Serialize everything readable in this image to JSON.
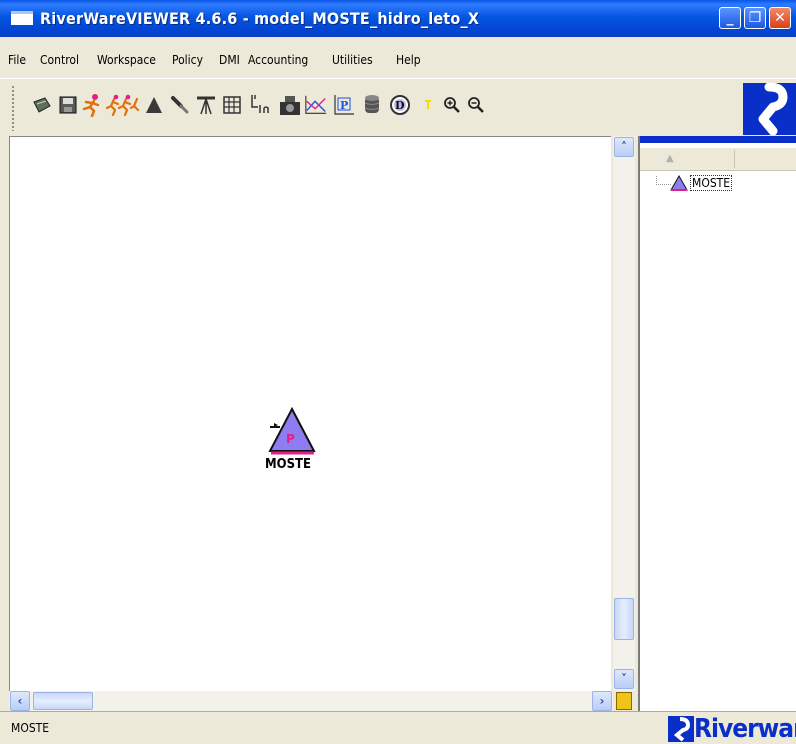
{
  "window": {
    "title": "RiverWareVIEWER 4.6.6 - model_MOSTE_hidro_leto_X",
    "controls": [
      "minimize",
      "restore",
      "close"
    ]
  },
  "menu": [
    "File",
    "Control",
    "Workspace",
    "Policy",
    "DMI",
    "Accounting",
    "Utilities",
    "Help"
  ],
  "toolbar": {
    "buttons": [
      {
        "icon": "open-icon"
      },
      {
        "icon": "save-icon"
      },
      {
        "icon": "run-icon"
      },
      {
        "icon": "run-multiple-icon"
      },
      {
        "icon": "object-palette-icon"
      },
      {
        "icon": "link-icon"
      },
      {
        "icon": "scope-icon"
      },
      {
        "icon": "table-icon"
      },
      {
        "icon": "slot-in-icon"
      },
      {
        "icon": "snapshot-icon"
      },
      {
        "icon": "plot-icon"
      },
      {
        "icon": "policy-icon"
      },
      {
        "icon": "database-icon"
      },
      {
        "icon": "dmi-icon"
      },
      {
        "icon": "accounting-icon"
      },
      {
        "icon": "zoom-in-icon"
      },
      {
        "icon": "zoom-out-icon"
      }
    ]
  },
  "workspace": {
    "node": {
      "label": "MOSTE",
      "badge": "P"
    }
  },
  "object_tree": {
    "items": [
      {
        "label": "MOSTE"
      }
    ]
  },
  "status": {
    "text": "MOSTE"
  },
  "brand": {
    "logo_text": "Riverware"
  },
  "colors": {
    "title_blue": "#0457e0",
    "brand_blue": "#0a2ec8",
    "node_purple": "#8e7cf0",
    "node_pink": "#e0208a"
  }
}
